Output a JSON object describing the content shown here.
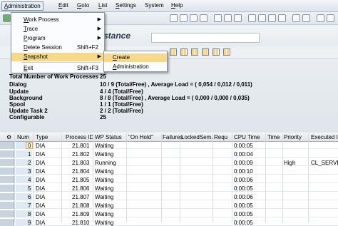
{
  "menubar": {
    "items": [
      {
        "label": "Administration",
        "u": "A",
        "rest": "dministration"
      },
      {
        "label": "Edit",
        "u": "E",
        "rest": "dit"
      },
      {
        "label": "Goto",
        "u": "G",
        "rest": "oto"
      },
      {
        "label": "List",
        "u": "L",
        "rest": "ist"
      },
      {
        "label": "Settings",
        "u": "S",
        "rest": "ettings"
      },
      {
        "label": "System",
        "u": "",
        "rest": "System"
      },
      {
        "label": "Help",
        "u": "H",
        "rest": "elp"
      }
    ]
  },
  "title": "stance",
  "admin_menu": {
    "items": [
      {
        "label": "Work Process",
        "u": "W",
        "rest": "ork Process",
        "shortcut": "",
        "submenu": true
      },
      {
        "label": "Trace",
        "u": "T",
        "rest": "race",
        "shortcut": "",
        "submenu": true
      },
      {
        "label": "Program",
        "u": "P",
        "rest": "rogram",
        "shortcut": "",
        "submenu": true
      },
      {
        "label": "Delete Session",
        "u": "D",
        "rest": "elete Session",
        "shortcut": "Shift+F2",
        "submenu": false
      },
      {
        "label": "Snapshot",
        "u": "S",
        "rest": "napshot",
        "shortcut": "",
        "submenu": true
      },
      {
        "label": "Exit",
        "u": "E",
        "rest": "xit",
        "shortcut": "Shift+F3",
        "submenu": false
      }
    ]
  },
  "snapshot_menu": {
    "items": [
      {
        "label": "Create",
        "u": "C",
        "rest": "reate"
      },
      {
        "label": "Administration",
        "u": "A",
        "rest": "dministration"
      }
    ]
  },
  "status": {
    "rows": [
      {
        "label": "Total Number of Work Processes",
        "value": "25"
      },
      {
        "label": "Dialog",
        "value": "10 / 9 (Total/Free) , Average Load = ( 0,054 / 0,012 / 0,011)"
      },
      {
        "label": "Update",
        "value": "4 / 4 (Total/Free)"
      },
      {
        "label": "Background",
        "value": "8 / 8 (Total/Free) , Average Load = ( 0,000 / 0,000 / 0,035)"
      },
      {
        "label": "Spool",
        "value": "1 / 1 (Total/Free)"
      },
      {
        "label": "Update Task 2",
        "value": "2 / 2 (Total/Free)"
      },
      {
        "label": "Configurable",
        "value": "25"
      }
    ]
  },
  "grid": {
    "columns": [
      "Num",
      "Type",
      "Process ID",
      "WP Status",
      "\"On Hold\"",
      "Failures",
      "LockedSem.",
      "Requ",
      "CPU Time",
      "Time",
      "Priority",
      "Executed In"
    ],
    "rows": [
      {
        "num": "0",
        "type": "DIA",
        "pid": "21.801",
        "status": "Waiting",
        "cpu": "0:00:05",
        "priority": "",
        "executed": ""
      },
      {
        "num": "1",
        "type": "DIA",
        "pid": "21.802",
        "status": "Waiting",
        "cpu": "0:00:04",
        "priority": "",
        "executed": ""
      },
      {
        "num": "2",
        "type": "DIA",
        "pid": "21.803",
        "status": "Running",
        "cpu": "0:00:09",
        "priority": "High",
        "executed": "CL_SERVER"
      },
      {
        "num": "3",
        "type": "DIA",
        "pid": "21.804",
        "status": "Waiting",
        "cpu": "0:00:10",
        "priority": "",
        "executed": ""
      },
      {
        "num": "4",
        "type": "DIA",
        "pid": "21.805",
        "status": "Waiting",
        "cpu": "0:00:06",
        "priority": "",
        "executed": ""
      },
      {
        "num": "5",
        "type": "DIA",
        "pid": "21.806",
        "status": "Waiting",
        "cpu": "0:00:05",
        "priority": "",
        "executed": ""
      },
      {
        "num": "6",
        "type": "DIA",
        "pid": "21.807",
        "status": "Waiting",
        "cpu": "0:00:06",
        "priority": "",
        "executed": ""
      },
      {
        "num": "7",
        "type": "DIA",
        "pid": "21.808",
        "status": "Waiting",
        "cpu": "0:00:05",
        "priority": "",
        "executed": ""
      },
      {
        "num": "8",
        "type": "DIA",
        "pid": "21.809",
        "status": "Waiting",
        "cpu": "0:00:05",
        "priority": "",
        "executed": ""
      },
      {
        "num": "9",
        "type": "DIA",
        "pid": "21.810",
        "status": "Waiting",
        "cpu": "0:00:05",
        "priority": "",
        "executed": ""
      }
    ]
  },
  "colors": {
    "menu_highlight": "#f7d98a",
    "numcol": "#dfe9f4"
  }
}
